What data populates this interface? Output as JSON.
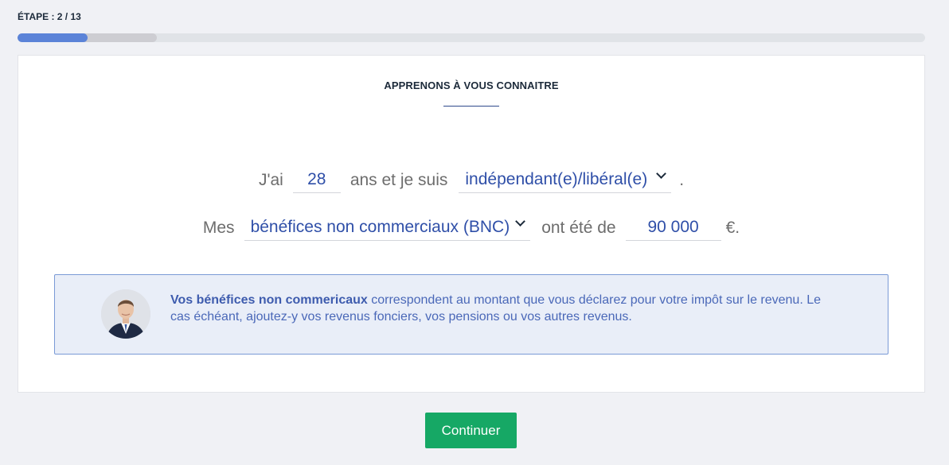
{
  "progress": {
    "step_label": "ÉTAPE : 2 / 13",
    "fraction": 0.0769,
    "color": "#5b83d8"
  },
  "card": {
    "title": "APPRENONS À VOUS CONNAITRE"
  },
  "sentence1": {
    "prefix": "J'ai",
    "age_value": "28",
    "middle": "ans et je suis",
    "status_value": "indépendant(e)/libéral(e)",
    "suffix": "."
  },
  "sentence2": {
    "prefix": "Mes",
    "income_type_value": "bénéfices non commerciaux (BNC)",
    "middle": "ont été de",
    "amount_value": "90 000",
    "suffix": "€."
  },
  "info": {
    "bold": "Vos bénéfices non commericaux",
    "text": " correspondent au montant que vous déclarez pour votre impôt sur le revenu. Le cas échéant, ajoutez-y vos revenus fonciers, vos pensions ou vos autres revenus."
  },
  "actions": {
    "continue_label": "Continuer",
    "continue_color": "#16a865"
  },
  "icons": [
    "chevron-down-icon",
    "advisor-avatar"
  ]
}
